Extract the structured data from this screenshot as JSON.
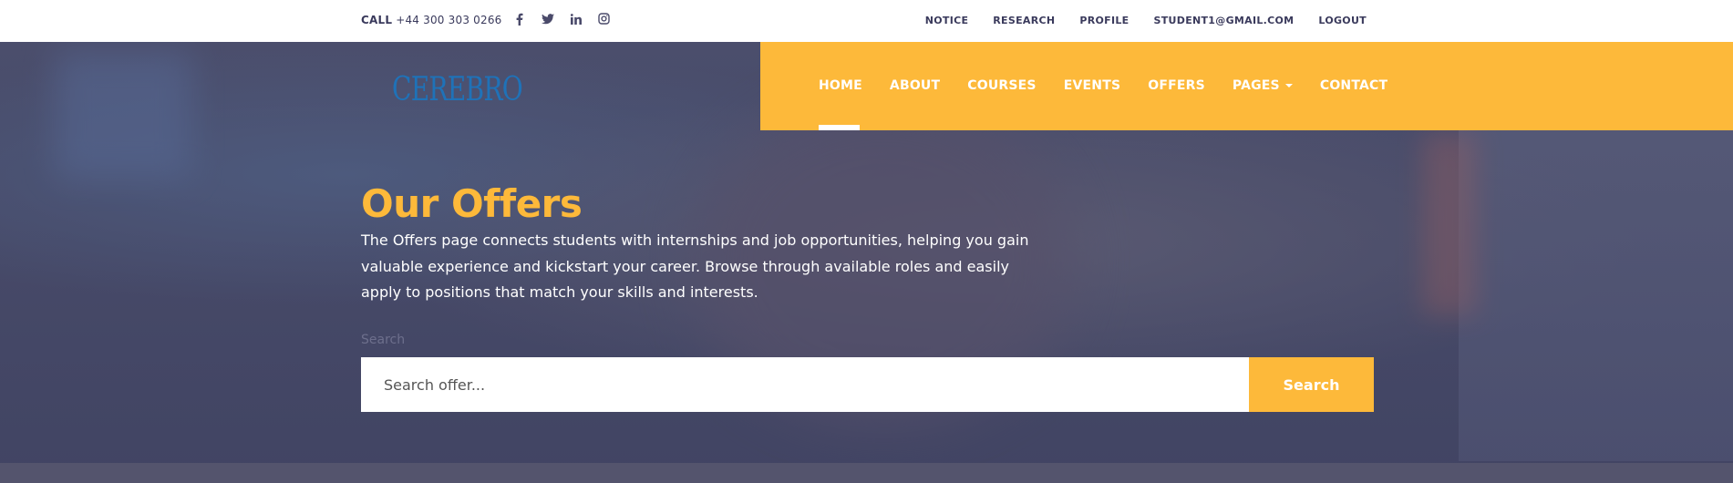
{
  "topbar": {
    "call_label": "CALL",
    "phone": "+44 300 303 0266",
    "socials": [
      "facebook-icon",
      "twitter-icon",
      "linkedin-icon",
      "instagram-icon"
    ],
    "links": [
      "NOTICE",
      "RESEARCH",
      "PROFILE",
      "STUDENT1@GMAIL.COM",
      "LOGOUT"
    ]
  },
  "brand": {
    "logo_text": "CEREBRO",
    "logo_color": "#1f72b8"
  },
  "nav": {
    "items": [
      "HOME",
      "ABOUT",
      "COURSES",
      "EVENTS",
      "OFFERS",
      "PAGES",
      "CONTACT"
    ],
    "active": "HOME",
    "background": "#fdb93a"
  },
  "hero": {
    "title": "Our Offers",
    "description": "The Offers page connects students with internships and job opportunities, helping you gain valuable experience and kickstart your career. Browse through available roles and easily apply to positions that match your skills and interests."
  },
  "search": {
    "label": "Search",
    "placeholder": "Search offer...",
    "button_label": "Search"
  }
}
